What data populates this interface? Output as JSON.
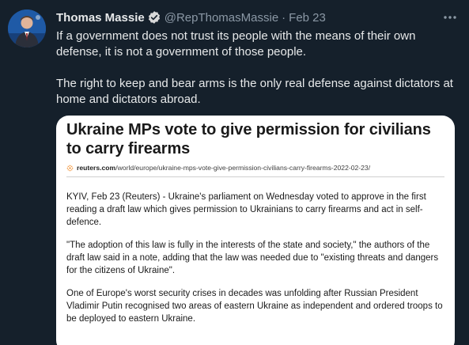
{
  "tweet": {
    "author_name": "Thomas Massie",
    "handle": "@RepThomasMassie",
    "separator": "·",
    "date": "Feb 23",
    "text_paragraphs": [
      "If a government does not trust its people with the means of their own defense, it is not a government of those people.",
      "The right to keep and bear arms is the only real defense against dictators at home and dictators abroad."
    ],
    "more_icon": "ellipsis-icon",
    "verified_icon": "verified-badge-icon"
  },
  "card": {
    "headline": "Ukraine MPs vote to give permission for civilians to carry firearms",
    "url_domain": "reuters.com",
    "url_path": "/world/europe/ukraine-mps-vote-give-permission-civilians-carry-firearms-2022-02-23/",
    "paragraphs": [
      "KYIV, Feb 23 (Reuters) - Ukraine's parliament on Wednesday voted to approve in the first reading a draft law which gives permission to Ukrainians to carry firearms and act in self-defence.",
      "\"The adoption of this law is fully in the interests of the state and society,\" the authors of the draft law said in a note, adding that the law was needed due to \"existing threats and dangers for the citizens of Ukraine\".",
      "One of Europe's worst security crises in decades was unfolding after Russian President Vladimir Putin recognised two areas of eastern Ukraine as independent and ordered troops to be deployed to eastern Ukraine."
    ]
  },
  "colors": {
    "background": "#15202b",
    "primary_text": "#e7e9ea",
    "secondary_text": "#8b98a5",
    "verified": "#1d9bf0",
    "card_bg": "#ffffff",
    "reuters_orange": "#f28c28"
  }
}
